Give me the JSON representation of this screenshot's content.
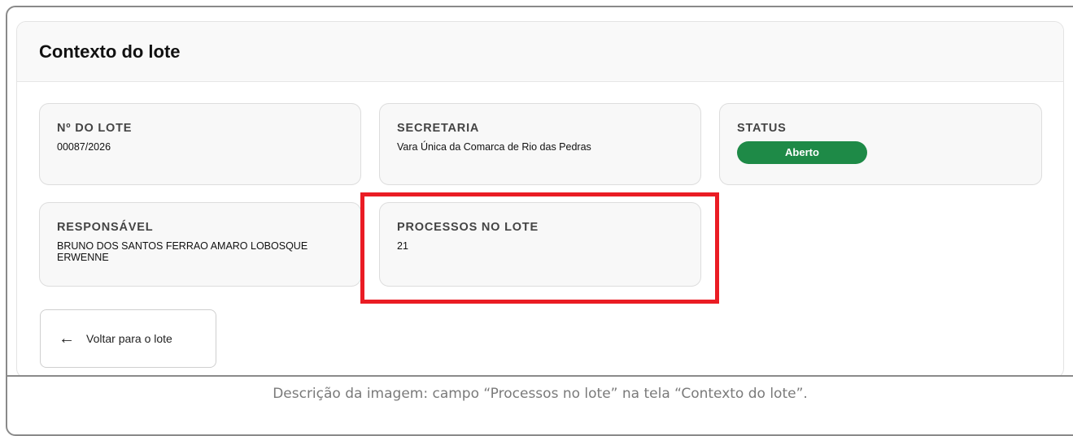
{
  "panel": {
    "title": "Contexto do lote"
  },
  "fields": {
    "lote": {
      "label": "Nº DO LOTE",
      "value": "00087/2026"
    },
    "secretaria": {
      "label": "SECRETARIA",
      "value": "Vara Única da Comarca de Rio das Pedras"
    },
    "status": {
      "label": "STATUS",
      "value": "Aberto",
      "color": "#1e8a47"
    },
    "responsavel": {
      "label": "RESPONSÁVEL",
      "value": "BRUNO DOS SANTOS FERRAO AMARO LOBOSQUE ERWENNE"
    },
    "processos": {
      "label": "PROCESSOS NO LOTE",
      "value": "21"
    }
  },
  "actions": {
    "back_label": "Voltar para o lote",
    "back_icon": "arrow-left-icon"
  },
  "highlight": {
    "color": "#ea1c24",
    "target": "PROCESSOS NO LOTE"
  },
  "caption": "Descrição da imagem: campo “Processos no lote” na tela “Contexto do lote”."
}
